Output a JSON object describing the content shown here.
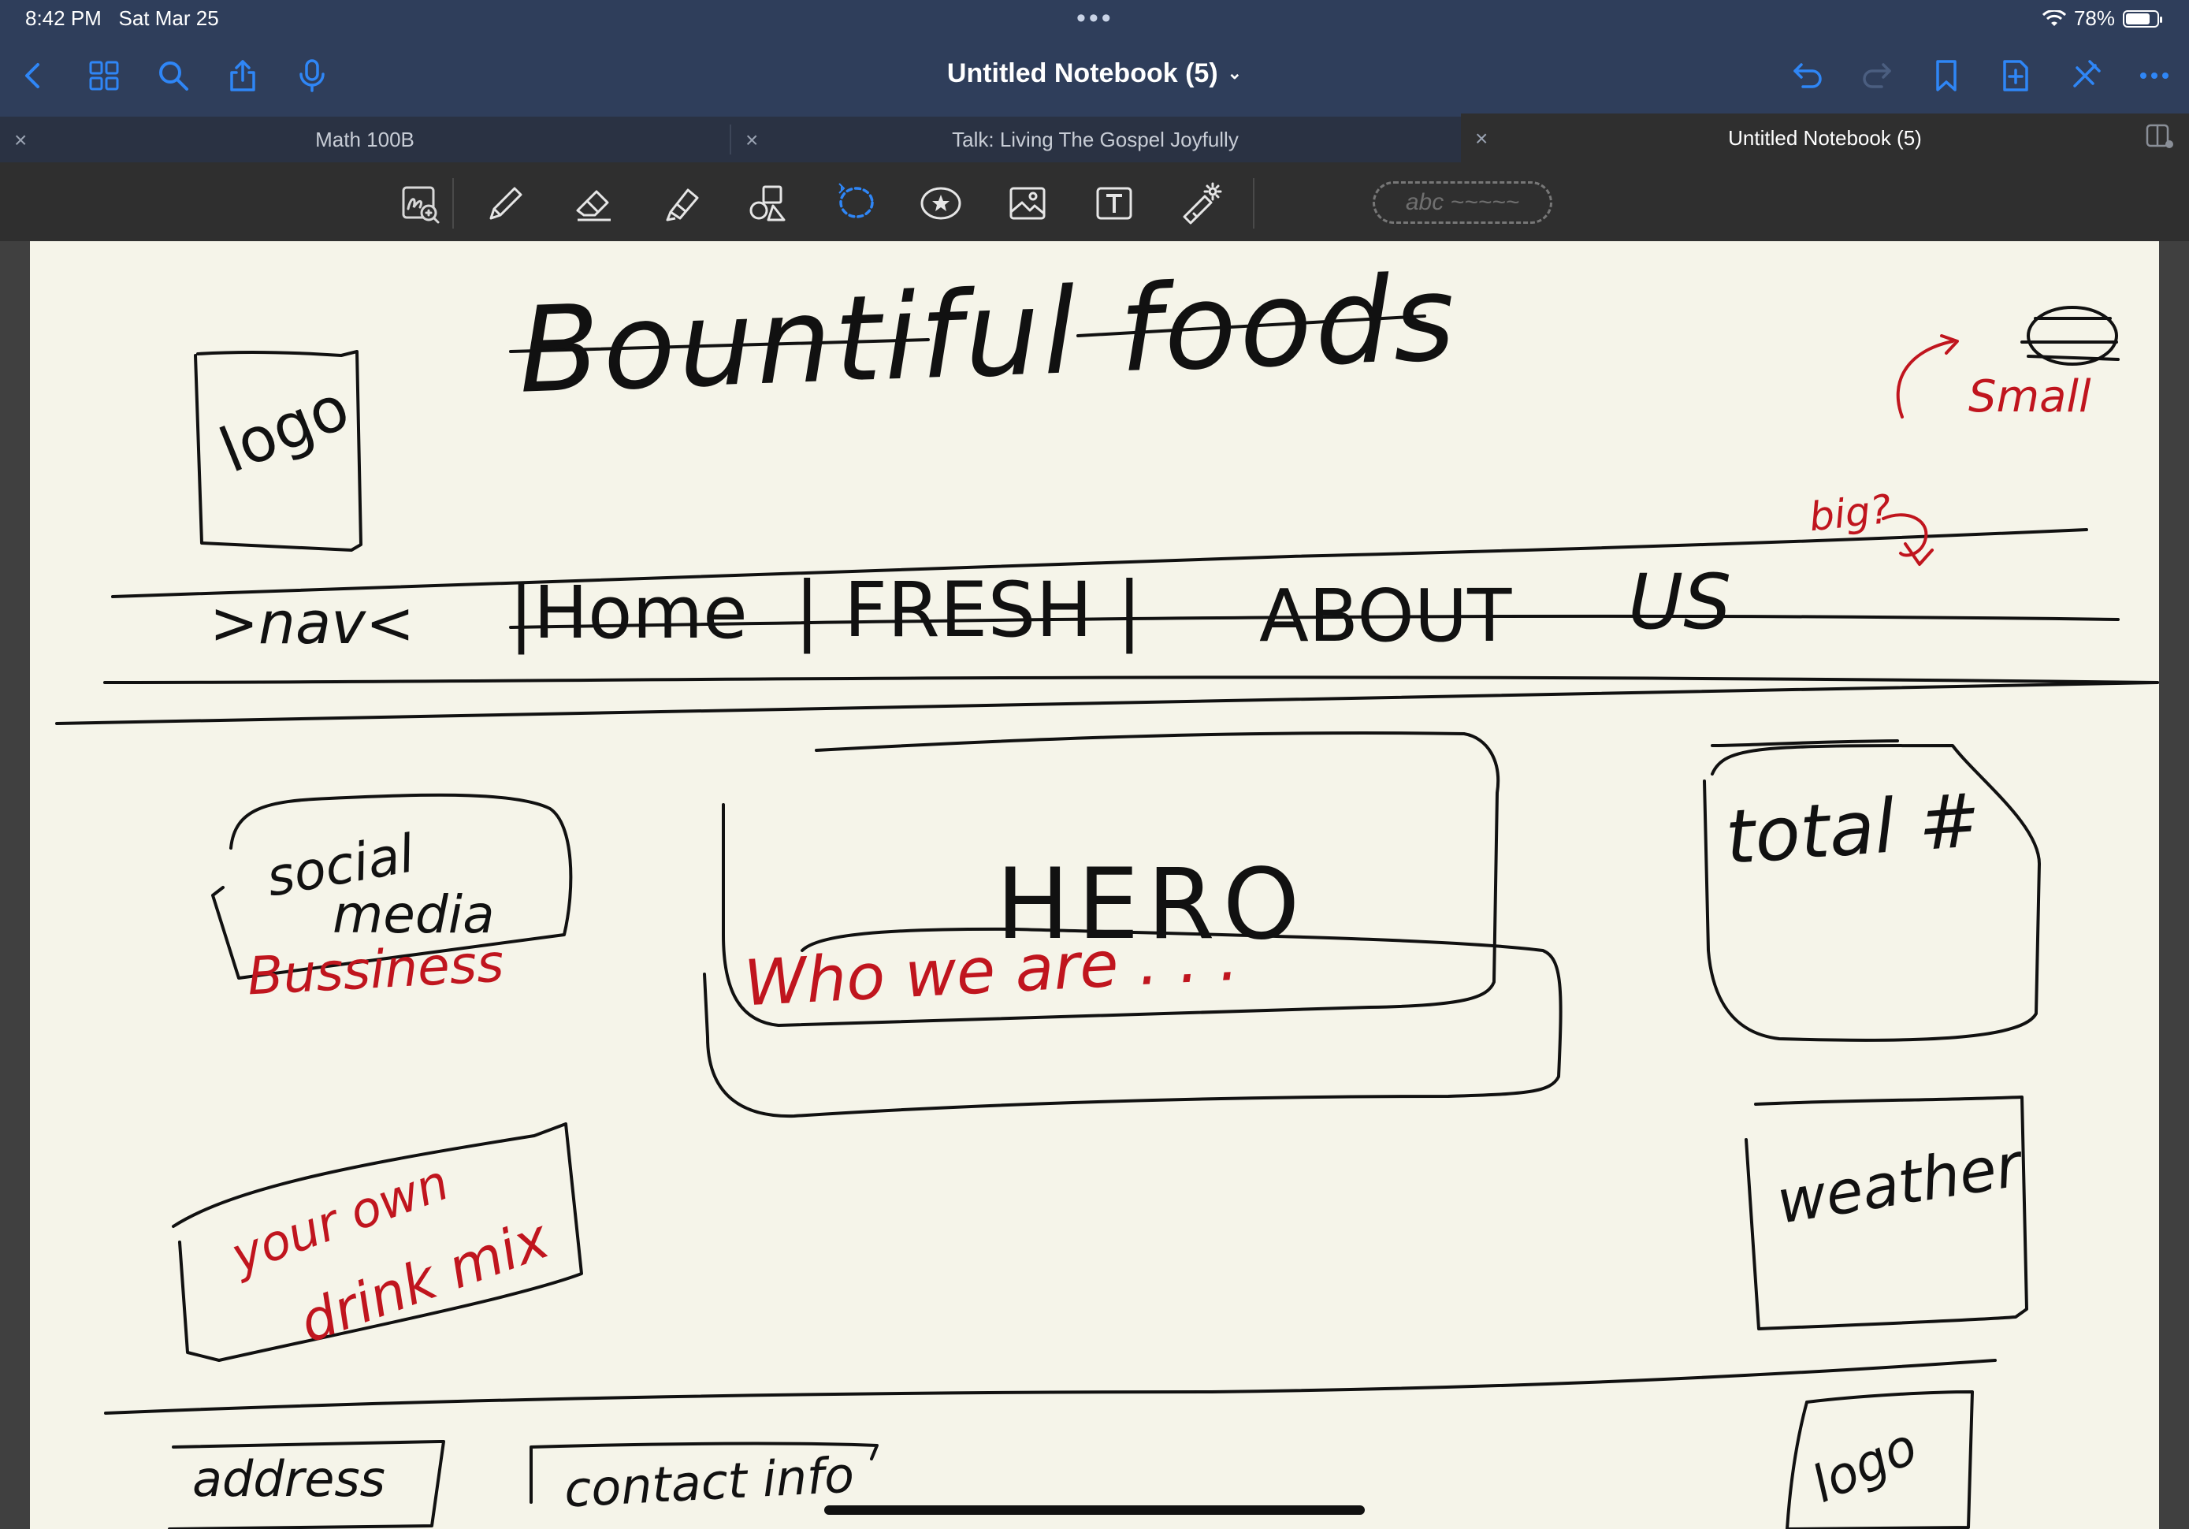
{
  "status_bar": {
    "time": "8:42 PM",
    "date": "Sat Mar 25",
    "battery": "78%",
    "battery_level": 0.78,
    "multitask_icon": "ellipsis-icon",
    "wifi_icon": "wifi-icon"
  },
  "nav": {
    "title": "Untitled Notebook (5)",
    "left_icons": [
      "back-chevron-icon",
      "grid-view-icon",
      "search-icon",
      "share-icon",
      "microphone-icon"
    ],
    "right_icons": [
      "undo-icon",
      "redo-icon",
      "bookmark-icon",
      "add-page-icon",
      "close-tool-icon",
      "more-icon"
    ]
  },
  "tabs": [
    {
      "label": "Math 100B",
      "active": false
    },
    {
      "label": "Talk: Living The Gospel Joyfully",
      "active": false
    },
    {
      "label": "Untitled Notebook (5)",
      "active": true
    }
  ],
  "toolbar": {
    "tools": [
      "lasso-zoom-icon",
      "pen-icon",
      "eraser-icon",
      "highlighter-icon",
      "shapes-icon",
      "lasso-icon",
      "sticker-icon",
      "image-icon",
      "text-icon",
      "laser-pointer-icon"
    ],
    "selected_tool": "lasso-icon",
    "handwriting_chip": "abc ~~~~~"
  },
  "sketch": {
    "title": "Bountiful foods",
    "logo_top": "logo",
    "note_small": "Small",
    "note_big": "big?",
    "nav_label": ">nav<",
    "nav_items": [
      "|Home",
      "| FRESH |",
      "ABOUT",
      "US"
    ],
    "social_line1": "social",
    "social_line2": "media",
    "social_red": "Bussiness",
    "hero": "HERO",
    "total": "total #",
    "who": "Who we are . . .",
    "drink_line1": "your own",
    "drink_line2": "drink mix",
    "weather": "weather",
    "address": "address",
    "contact": "contact info",
    "logo_bottom": "logo"
  },
  "colors": {
    "nav_bg": "#2f3e5b",
    "accent": "#2f86f6",
    "paper": "#f5f4e9",
    "ink_black": "#111111",
    "ink_red": "#c0151e"
  }
}
